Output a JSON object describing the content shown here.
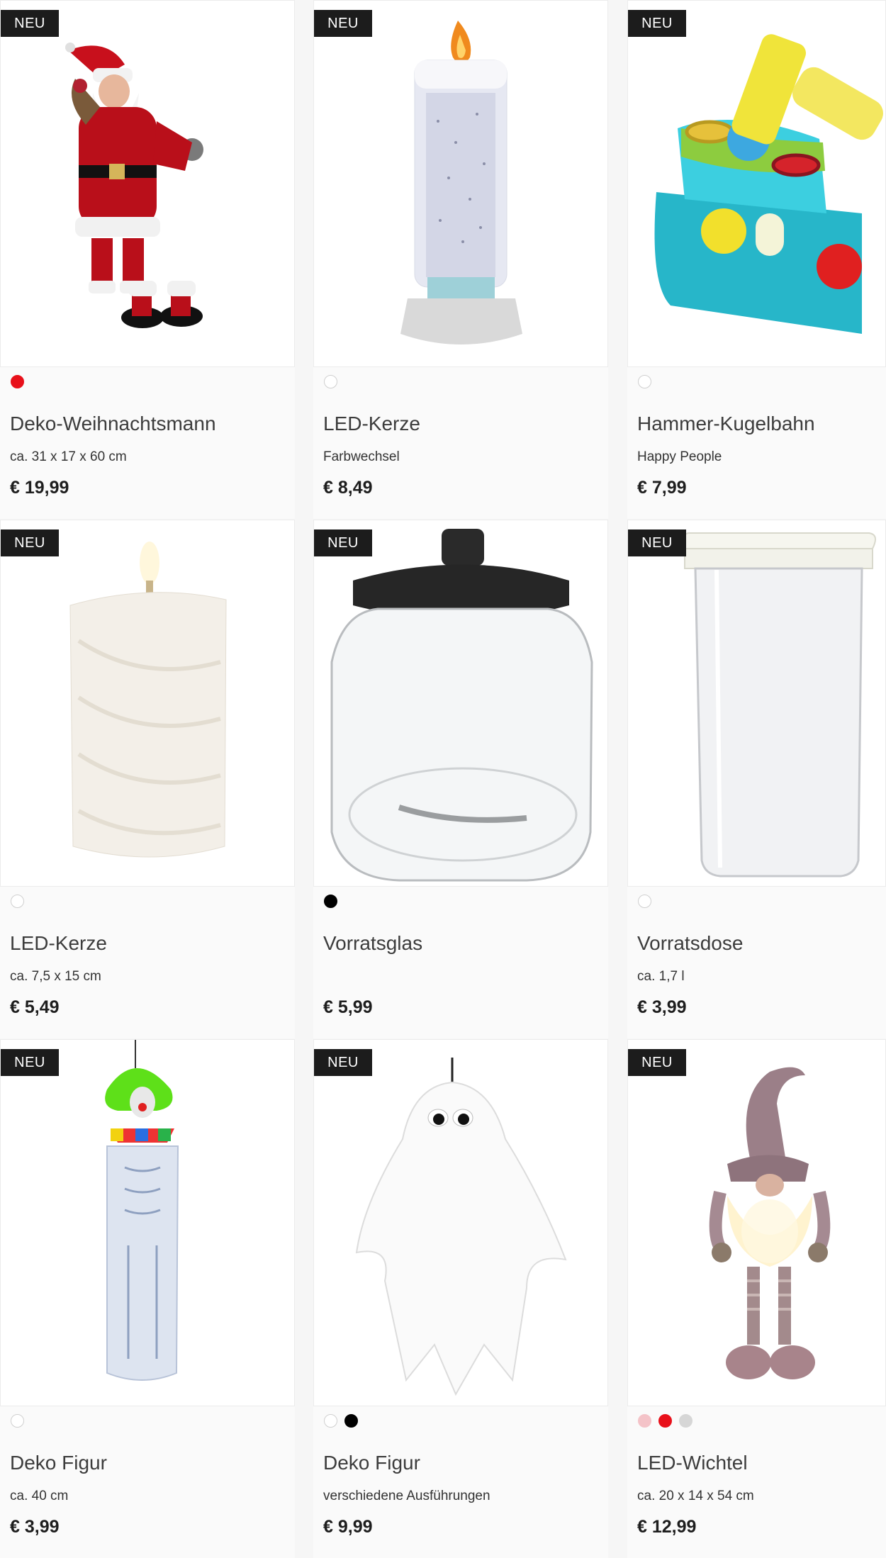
{
  "badge_label": "NEU",
  "products": [
    {
      "name": "Deko-Weihnachtsmann",
      "subtitle": "ca. 31 x 17 x 60 cm",
      "price": "€ 19,99",
      "image_icon": "santa-figure-icon",
      "swatches": [
        "#e8101a"
      ]
    },
    {
      "name": "LED-Kerze",
      "subtitle": "Farbwechsel",
      "price": "€ 8,49",
      "image_icon": "glitter-candle-icon",
      "swatches": [
        "#ffffff"
      ]
    },
    {
      "name": "Hammer-Kugelbahn",
      "subtitle": "Happy People",
      "price": "€ 7,99",
      "image_icon": "hammer-toy-icon",
      "swatches": [
        "#ffffff"
      ]
    },
    {
      "name": "LED-Kerze",
      "subtitle": "ca. 7,5 x 15 cm",
      "price": "€ 5,49",
      "image_icon": "pillar-candle-icon",
      "swatches": [
        "#ffffff"
      ]
    },
    {
      "name": "Vorratsglas",
      "subtitle": "",
      "price": "€ 5,99",
      "image_icon": "storage-jar-icon",
      "swatches": [
        "#000000"
      ]
    },
    {
      "name": "Vorratsdose",
      "subtitle": "ca. 1,7 l",
      "price": "€ 3,99",
      "image_icon": "storage-box-icon",
      "swatches": [
        "#ffffff"
      ]
    },
    {
      "name": "Deko Figur",
      "subtitle": "ca. 40 cm",
      "price": "€ 3,99",
      "image_icon": "clown-skeleton-icon",
      "swatches": [
        "#ffffff"
      ]
    },
    {
      "name": "Deko Figur",
      "subtitle": "verschiedene Ausführungen",
      "price": "€ 9,99",
      "image_icon": "ghost-figure-icon",
      "swatches": [
        "#ffffff",
        "#000000"
      ]
    },
    {
      "name": "LED-Wichtel",
      "subtitle": "ca. 20 x 14 x 54 cm",
      "price": "€ 12,99",
      "image_icon": "gnome-figure-icon",
      "swatches": [
        "#f4c3c8",
        "#e8101a",
        "#d6d6d6"
      ]
    }
  ]
}
